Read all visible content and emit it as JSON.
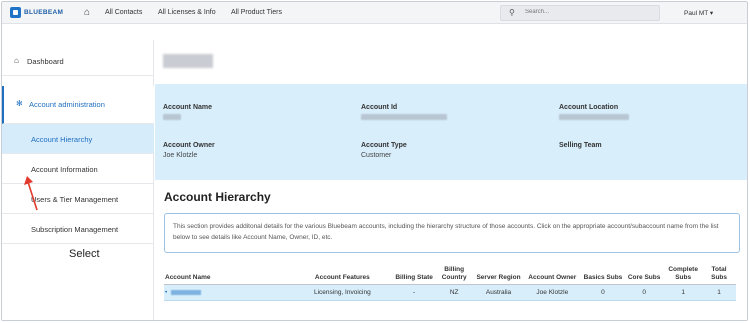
{
  "topbar": {
    "logo_text": "BLUEBEAM",
    "nav_links": [
      "All Contacts",
      "All Licenses & Info",
      "All Product Tiers"
    ],
    "search_placeholder": "Search...",
    "user_menu": "Paul MT ▾"
  },
  "sidebar": {
    "items": [
      {
        "label": "Dashboard",
        "icon": "home-icon"
      },
      {
        "label": "Account administration",
        "icon": "gear-icon"
      },
      {
        "label": "Account Hierarchy"
      },
      {
        "label": "Account Information"
      },
      {
        "label": "Users & Tier Management"
      },
      {
        "label": "Subscription Management"
      }
    ]
  },
  "annotation": {
    "label": "Select"
  },
  "account": {
    "fields": [
      {
        "label": "Account Name",
        "value": ""
      },
      {
        "label": "Account Id",
        "value": ""
      },
      {
        "label": "Account Location",
        "value": ""
      },
      {
        "label": "Account Owner",
        "value": "Joe Klotzle"
      },
      {
        "label": "Account Type",
        "value": "Customer"
      },
      {
        "label": "Selling Team",
        "value": ""
      }
    ]
  },
  "hierarchy": {
    "title": "Account Hierarchy",
    "notice": "This section provides additonal details for the various Bluebeam accounts, including the hierarchy structure of those accounts. Click on the appropriate account/subaccount name from the list below to see details like Account Name, Owner, ID, etc.",
    "columns": [
      "Account Name",
      "Account Features",
      "Billing State",
      "Billing Country",
      "Server Region",
      "Account Owner",
      "Basics Subs",
      "Core Subs",
      "Complete Subs",
      "Total Subs"
    ],
    "rows": [
      [
        "",
        "Licensing, Invoicing",
        "-",
        "NZ",
        "Australia",
        "Joe Klotzle",
        "0",
        "0",
        "1",
        "1"
      ]
    ]
  }
}
